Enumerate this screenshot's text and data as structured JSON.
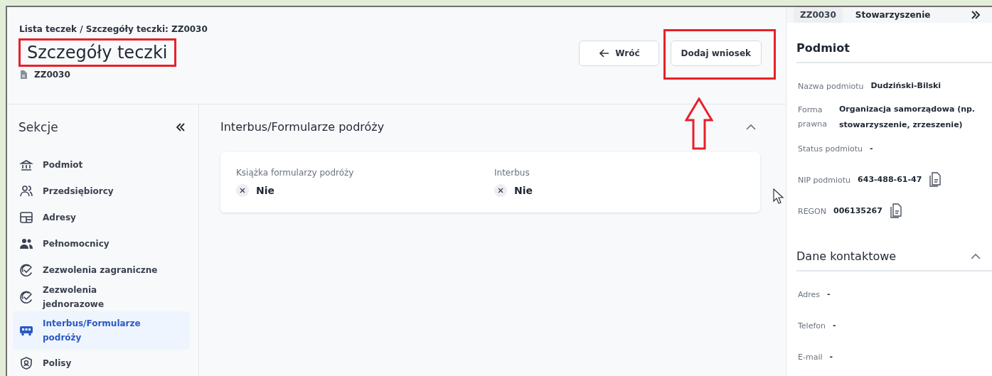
{
  "breadcrumb": {
    "items": [
      "Lista teczek",
      "Szczegóły teczki: ZZ0030"
    ],
    "separator": "/"
  },
  "header": {
    "title": "Szczegóły teczki",
    "title_highlighted": true,
    "file_id": "ZZ0030"
  },
  "actions": [
    {
      "kind": "back",
      "label": "Wróć",
      "highlighted": false
    },
    {
      "kind": "plain",
      "label": "Dodaj wniosek",
      "highlighted": true
    }
  ],
  "sidebar": {
    "title": "Sekcje",
    "items": [
      {
        "kind": "bank",
        "label": "Podmiot",
        "selected": false
      },
      {
        "kind": "people",
        "label": "Przedsiębiorcy",
        "selected": false
      },
      {
        "kind": "layout",
        "label": "Adresy",
        "selected": false
      },
      {
        "kind": "people-filled",
        "label": "Pełnomocnicy",
        "selected": false
      },
      {
        "kind": "check",
        "label": "Zezwolenia zagraniczne",
        "selected": false
      },
      {
        "kind": "check",
        "label": "Zezwolenia jednorazowe",
        "selected": false
      },
      {
        "kind": "bus",
        "label": "Interbus/Formularze podróży",
        "selected": true
      },
      {
        "kind": "shield",
        "label": "Polisy",
        "selected": false
      }
    ]
  },
  "section": {
    "title": "Interbus/Formularze podróży",
    "expanded": true,
    "fields": [
      {
        "label": "Książka formularzy podróży",
        "value": "Nie"
      },
      {
        "label": "Interbus",
        "value": "Nie"
      }
    ]
  },
  "panel": {
    "chip": "ZZ0030",
    "type": "Stowarzyszenie",
    "groups": [
      {
        "title": "Podmiot",
        "collapsible": false,
        "fields": [
          {
            "label": "Nazwa podmiotu",
            "value": "Dudziński-Bilski",
            "copy": false
          },
          {
            "label": "Forma prawna",
            "value": "Organizacja samorządowa (np. stowarzyszenie, zrzeszenie)",
            "copy": false
          },
          {
            "label": "Status podmiotu",
            "value": "-",
            "copy": false
          },
          {
            "label": "NIP podmiotu",
            "value": "643-488-61-47",
            "copy": true
          },
          {
            "label": "REGON",
            "value": "006135267",
            "copy": true
          }
        ]
      },
      {
        "title": "Dane kontaktowe",
        "collapsible": true,
        "fields": [
          {
            "label": "Adres",
            "value": "-",
            "copy": false
          },
          {
            "label": "Telefon",
            "value": "-",
            "copy": false
          },
          {
            "label": "E-mail",
            "value": "-",
            "copy": false
          }
        ]
      }
    ]
  }
}
